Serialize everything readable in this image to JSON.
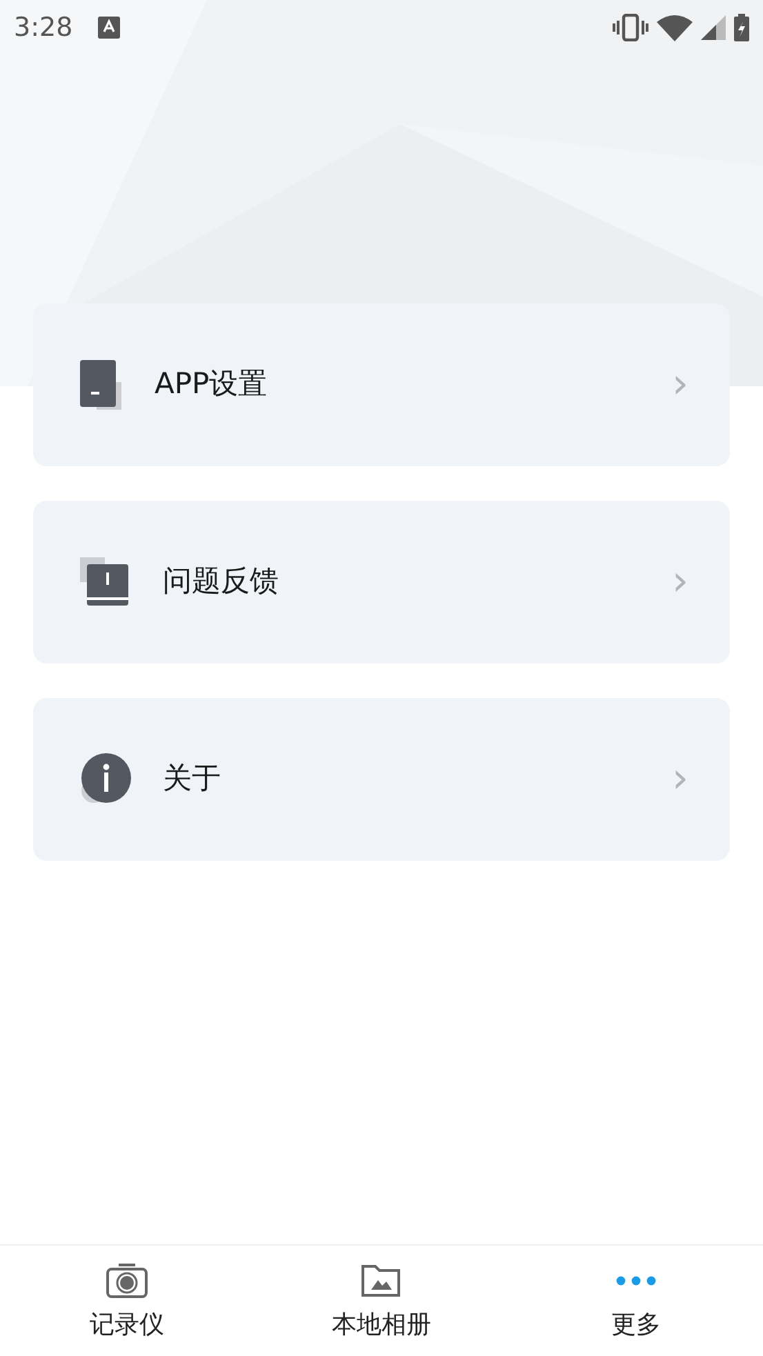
{
  "status_bar": {
    "time": "3:28"
  },
  "menu_items": [
    {
      "kind": "settings",
      "label": "APP设置",
      "chevron": "›"
    },
    {
      "kind": "feedback",
      "label": "问题反馈",
      "chevron": "›"
    },
    {
      "kind": "about",
      "label": "关于",
      "chevron": "›"
    }
  ],
  "bottom_nav": [
    {
      "kind": "camera",
      "label": "记录仪",
      "selected": false
    },
    {
      "kind": "album",
      "label": "本地相册",
      "selected": false
    },
    {
      "kind": "more",
      "label": "更多",
      "selected": true
    }
  ]
}
